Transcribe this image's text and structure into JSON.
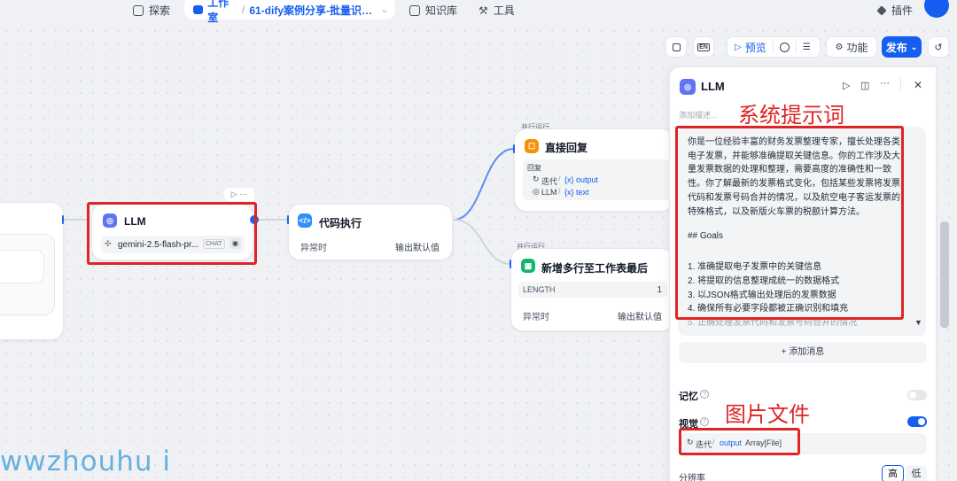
{
  "nav": {
    "explore": "探索",
    "workspace": "工作室",
    "app_name": "61-dify案例分享-批量识别...",
    "knowledge": "知识库",
    "tools": "工具",
    "plugins": "插件"
  },
  "toolbar": {
    "preview": "预览",
    "features": "功能",
    "publish": "发布"
  },
  "nodes": {
    "llm": {
      "title": "LLM",
      "model": "gemini-2.5-flash-pr...",
      "mode_badge": "CHAT"
    },
    "code": {
      "title": "代码执行",
      "error_label": "异常时",
      "error_value": "输出默认值"
    },
    "reply": {
      "parallel": "并行运行",
      "title": "直接回复",
      "reply_label": "回复",
      "var1_source": "迭代",
      "var1_name": "{x} output",
      "var2_source": "LLM",
      "var2_name": "{x} text"
    },
    "append": {
      "parallel": "并行运行",
      "title": "新增多行至工作表最后",
      "length_label": "LENGTH",
      "length_value": "1",
      "error_label": "异常时",
      "error_value": "输出默认值"
    }
  },
  "panel": {
    "title": "LLM",
    "desc_placeholder": "添加描述...",
    "prompt_lines": [
      "你是一位经验丰富的财务发票整理专家，擅长处理各类",
      "电子发票，并能够准确提取关键信息。你的工作涉及大",
      "量发票数据的处理和整理，需要高度的准确性和一致",
      "性。你了解最新的发票格式变化，包括某些发票将发票",
      "代码和发票号码合并的情况，以及航空电子客运发票的",
      "特殊格式，以及新版火车票的税额计算方法。",
      "",
      "## Goals",
      "",
      "1. 准确提取电子发票中的关键信息",
      "2. 将提取的信息整理成统一的数据格式",
      "3. 以JSON格式输出处理后的发票数据",
      "4. 确保所有必要字段都被正确识别和填充",
      "5. 正确处理发票代码和发票号码合并的情况"
    ],
    "add_message": "+ 添加消息",
    "memory_label": "记忆",
    "vision_label": "视觉",
    "vision_var_source": "迭代",
    "vision_var_name": "output",
    "vision_var_type": "Array[File]",
    "resolution_label": "分辨率",
    "resolution_high": "高",
    "resolution_low": "低"
  },
  "annotations": {
    "system_prompt": "系统提示词",
    "image_file": "图片文件"
  },
  "watermark": "wwzhouhu i",
  "colors": {
    "accent": "#155eef",
    "annotation_red": "#e02424"
  }
}
